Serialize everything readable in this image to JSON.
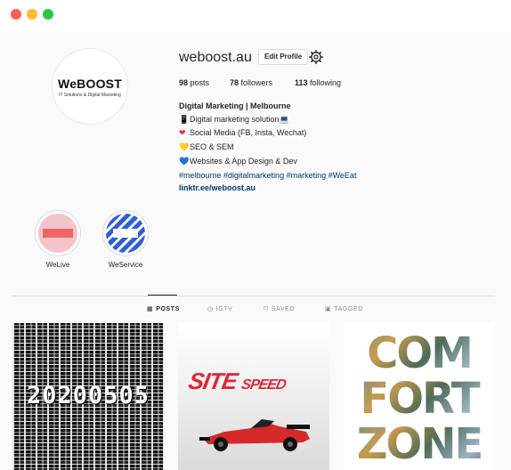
{
  "window": {
    "controls": [
      "close",
      "minimize",
      "maximize"
    ]
  },
  "profile": {
    "avatar": {
      "brand": "WeBOOST",
      "tagline": "IT Solutions & Digital Marketing"
    },
    "username": "weboost.au",
    "edit_label": "Edit Profile",
    "settings_icon": "gear-icon",
    "stats": {
      "posts_count": "98",
      "posts_label": "posts",
      "followers_count": "78",
      "followers_label": "followers",
      "following_count": "113",
      "following_label": "following"
    },
    "bio": {
      "name": "Digital Marketing | Melbourne",
      "lines": [
        {
          "emoji": "📱",
          "text": "Digital marketing solution💻"
        },
        {
          "emoji": "❤",
          "text": "Social Media (FB, Insta, Wechat)"
        },
        {
          "emoji": "💛",
          "text": "SEO & SEM"
        },
        {
          "emoji": "💙",
          "text": "Websites & App Design & Dev"
        }
      ],
      "hashtags": "#melbourne #digitalmarketing #marketing #WeEat",
      "link": "linktr.ee/weboost.au"
    }
  },
  "highlights": [
    {
      "label": "WeLive"
    },
    {
      "label": "WeService"
    }
  ],
  "tabs": [
    {
      "label": "POSTS",
      "icon": "grid-icon",
      "active": true
    },
    {
      "label": "IGTV",
      "icon": "igtv-icon",
      "active": false
    },
    {
      "label": "SAVED",
      "icon": "bookmark-icon",
      "active": false
    },
    {
      "label": "TAGGED",
      "icon": "tag-icon",
      "active": false
    }
  ],
  "posts": [
    {
      "text": "20200505"
    },
    {
      "title_main": "SITE",
      "title_sub": "SPEED"
    },
    {
      "words": [
        "COM",
        "FORT",
        "ZONE"
      ]
    }
  ],
  "colors": {
    "link": "#00376b",
    "accent_red": "#e0263a",
    "border": "#dbdbdb"
  }
}
